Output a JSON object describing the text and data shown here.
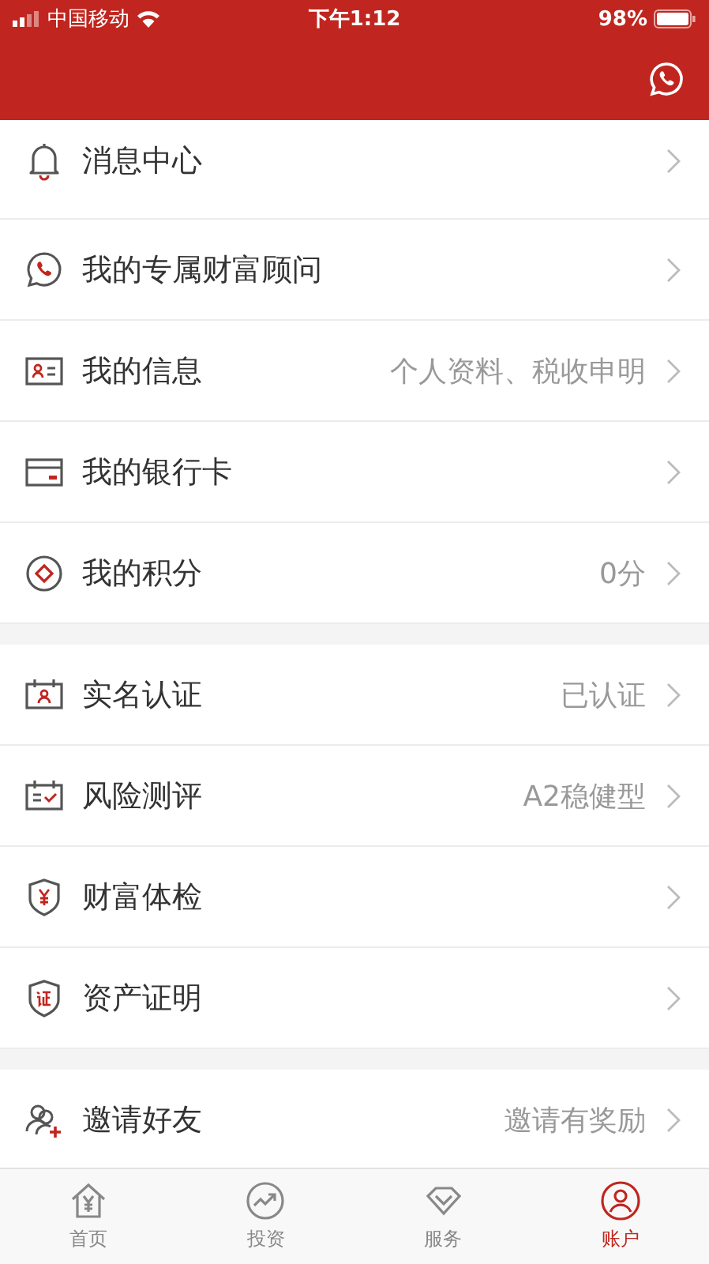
{
  "status_bar": {
    "carrier": "中国移动",
    "time": "下午1:12",
    "battery": "98%"
  },
  "sections": [
    {
      "items": [
        {
          "label": "消息中心"
        },
        {
          "label": "我的专属财富顾问"
        },
        {
          "label": "我的信息",
          "value": "个人资料、税收申明"
        },
        {
          "label": "我的银行卡"
        },
        {
          "label": "我的积分",
          "value": "0分"
        }
      ]
    },
    {
      "items": [
        {
          "label": "实名认证",
          "value": "已认证"
        },
        {
          "label": "风险测评",
          "value": "A2稳健型"
        },
        {
          "label": "财富体检"
        },
        {
          "label": "资产证明"
        }
      ]
    },
    {
      "items": [
        {
          "label": "邀请好友",
          "value": "邀请有奖励"
        }
      ]
    }
  ],
  "tab_bar": [
    {
      "label": "首页",
      "selected": false
    },
    {
      "label": "投资",
      "selected": false
    },
    {
      "label": "服务",
      "selected": false
    },
    {
      "label": "账户",
      "selected": true
    }
  ]
}
